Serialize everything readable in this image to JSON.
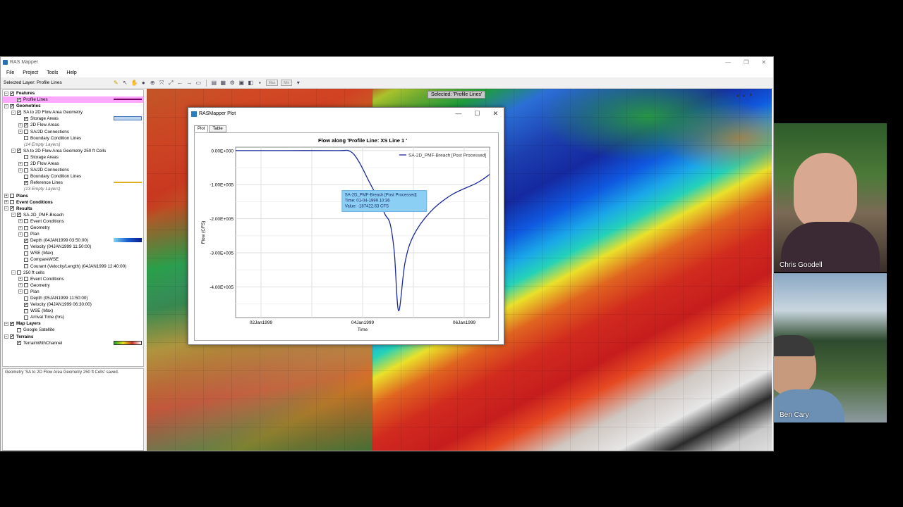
{
  "window": {
    "title": "RAS Mapper"
  },
  "menu": [
    "File",
    "Project",
    "Tools",
    "Help"
  ],
  "toolbar": {
    "selected_layer": "Selected Layer: Profile Lines",
    "max_label": "Max",
    "min_label": "Min"
  },
  "map": {
    "selected_badge": "Selected: 'Profile Lines'"
  },
  "status_message": "Geometry 'SA to 2D Flow Area Geometry 250 ft Cells' saved.",
  "tree": [
    {
      "label": "Features",
      "indent": 0,
      "exp": "-",
      "cb": true,
      "bold": true
    },
    {
      "label": "Profile Lines",
      "indent": 1,
      "exp": "",
      "cb": true,
      "hl": true,
      "legend": "line-magenta"
    },
    {
      "label": "Geometries",
      "indent": 0,
      "exp": "-",
      "cb": true,
      "bold": true
    },
    {
      "label": "SA to 2D Flow Area Geometry",
      "indent": 1,
      "exp": "-",
      "cb": true
    },
    {
      "label": "Storage Areas",
      "indent": 2,
      "exp": "",
      "cb": true,
      "legend": "box-blue"
    },
    {
      "label": "2D Flow Areas",
      "indent": 2,
      "exp": "+",
      "cb": true
    },
    {
      "label": "SA/2D Connections",
      "indent": 2,
      "exp": "+",
      "cb": false
    },
    {
      "label": "Boundary Condition Lines",
      "indent": 2,
      "exp": "",
      "cb": false
    },
    {
      "label": "(14 Empty Layers)",
      "indent": 2,
      "exp": "",
      "cb": null,
      "italic": true
    },
    {
      "label": "SA to 2D Flow Area Geometry 250 ft Cells",
      "indent": 1,
      "exp": "-",
      "cb": true
    },
    {
      "label": "Storage Areas",
      "indent": 2,
      "exp": "",
      "cb": false
    },
    {
      "label": "2D Flow Areas",
      "indent": 2,
      "exp": "+",
      "cb": false
    },
    {
      "label": "SA/2D Connections",
      "indent": 2,
      "exp": "+",
      "cb": false
    },
    {
      "label": "Boundary Condition Lines",
      "indent": 2,
      "exp": "",
      "cb": false
    },
    {
      "label": "Reference Lines",
      "indent": 2,
      "exp": "",
      "cb": true,
      "legend": "line-gold"
    },
    {
      "label": "(13 Empty Layers)",
      "indent": 2,
      "exp": "",
      "cb": null,
      "italic": true
    },
    {
      "label": "Plans",
      "indent": 0,
      "exp": "+",
      "cb": false,
      "bold": true
    },
    {
      "label": "Event Conditions",
      "indent": 0,
      "exp": "+",
      "cb": false,
      "bold": true
    },
    {
      "label": "Results",
      "indent": 0,
      "exp": "-",
      "cb": true,
      "bold": true
    },
    {
      "label": "SA-2D_PMF-Breach",
      "indent": 1,
      "exp": "-",
      "cb": true
    },
    {
      "label": "Event Conditions",
      "indent": 2,
      "exp": "+",
      "cb": false
    },
    {
      "label": "Geometry",
      "indent": 2,
      "exp": "+",
      "cb": false
    },
    {
      "label": "Plan",
      "indent": 2,
      "exp": "+",
      "cb": false
    },
    {
      "label": "Depth (04JAN1999 03:50:00)",
      "indent": 2,
      "exp": "",
      "cb": true,
      "legend": "ramp-blue"
    },
    {
      "label": "Velocity (04JAN1999 11:50:00)",
      "indent": 2,
      "exp": "",
      "cb": false
    },
    {
      "label": "WSE (Max)",
      "indent": 2,
      "exp": "",
      "cb": false
    },
    {
      "label": "CompareWSE",
      "indent": 2,
      "exp": "",
      "cb": false
    },
    {
      "label": "Courant (Velocity/Length) (04JAN1999 12:40:00)",
      "indent": 2,
      "exp": "",
      "cb": false
    },
    {
      "label": "250 ft cells",
      "indent": 1,
      "exp": "-",
      "cb": false
    },
    {
      "label": "Event Conditions",
      "indent": 2,
      "exp": "+",
      "cb": false
    },
    {
      "label": "Geometry",
      "indent": 2,
      "exp": "+",
      "cb": false
    },
    {
      "label": "Plan",
      "indent": 2,
      "exp": "+",
      "cb": false
    },
    {
      "label": "Depth (05JAN1999 11:50:00)",
      "indent": 2,
      "exp": "",
      "cb": false
    },
    {
      "label": "Velocity (04JAN1999 06:30:00)",
      "indent": 2,
      "exp": "",
      "cb": true
    },
    {
      "label": "WSE (Max)",
      "indent": 2,
      "exp": "",
      "cb": false
    },
    {
      "label": "Arrival Time (hrs)",
      "indent": 2,
      "exp": "",
      "cb": false
    },
    {
      "label": "Map Layers",
      "indent": 0,
      "exp": "-",
      "cb": true,
      "bold": true
    },
    {
      "label": "Google Satellite",
      "indent": 1,
      "exp": "",
      "cb": false
    },
    {
      "label": "Terrains",
      "indent": 0,
      "exp": "-",
      "cb": true,
      "bold": true
    },
    {
      "label": "TerrainWithChannel",
      "indent": 1,
      "exp": "",
      "cb": true,
      "legend": "ramp-terrain"
    }
  ],
  "plot": {
    "window_title": "RASMapper Plot",
    "tabs": [
      "Plot",
      "Table"
    ]
  },
  "tooltip": {
    "lines": [
      "SA-2D_PMF-Breach [Post Processed]",
      "Time:  01-04-1999 10:36",
      "Value: -187422.63 CFS"
    ]
  },
  "chart_data": {
    "type": "line",
    "title": "Flow along 'Profile Line: XS Line 1 '",
    "xlabel": "Time",
    "ylabel": "Flow (CFS)",
    "xlim": [
      "1999-01-01T12:00",
      "1999-01-06T12:00"
    ],
    "ylim": [
      -490000,
      10000
    ],
    "xticks": [
      "02Jan1999",
      "04Jan1999",
      "06Jan1999"
    ],
    "yticks": [
      "0.00E+000",
      "-1.00E+005",
      "-2.00E+005",
      "-3.00E+005",
      "-4.00E+005"
    ],
    "legend": "top-right",
    "grid": true,
    "series": [
      {
        "name": "SA-2D_PMF-Breach [Post Processed]",
        "color": "#1a2a9a",
        "points": [
          [
            "1999-01-01T12:00",
            0
          ],
          [
            "1999-01-02T12:00",
            0
          ],
          [
            "1999-01-03T12:00",
            0
          ],
          [
            "1999-01-03T18:00",
            -2000
          ],
          [
            "1999-01-03T22:00",
            -30000
          ],
          [
            "1999-01-04T03:00",
            -90000
          ],
          [
            "1999-01-04T08:00",
            -150000
          ],
          [
            "1999-01-04T10:36",
            -187422.63
          ],
          [
            "1999-01-04T13:00",
            -215000
          ],
          [
            "1999-01-04T15:00",
            -300000
          ],
          [
            "1999-01-04T17:00",
            -470000
          ],
          [
            "1999-01-04T20:00",
            -330000
          ],
          [
            "1999-01-05T00:00",
            -250000
          ],
          [
            "1999-01-05T08:00",
            -180000
          ],
          [
            "1999-01-05T18:00",
            -130000
          ],
          [
            "1999-01-06T06:00",
            -95000
          ],
          [
            "1999-01-06T12:00",
            -70000
          ]
        ]
      }
    ]
  },
  "webcams": [
    "Chris Goodell",
    "Ben Cary"
  ]
}
